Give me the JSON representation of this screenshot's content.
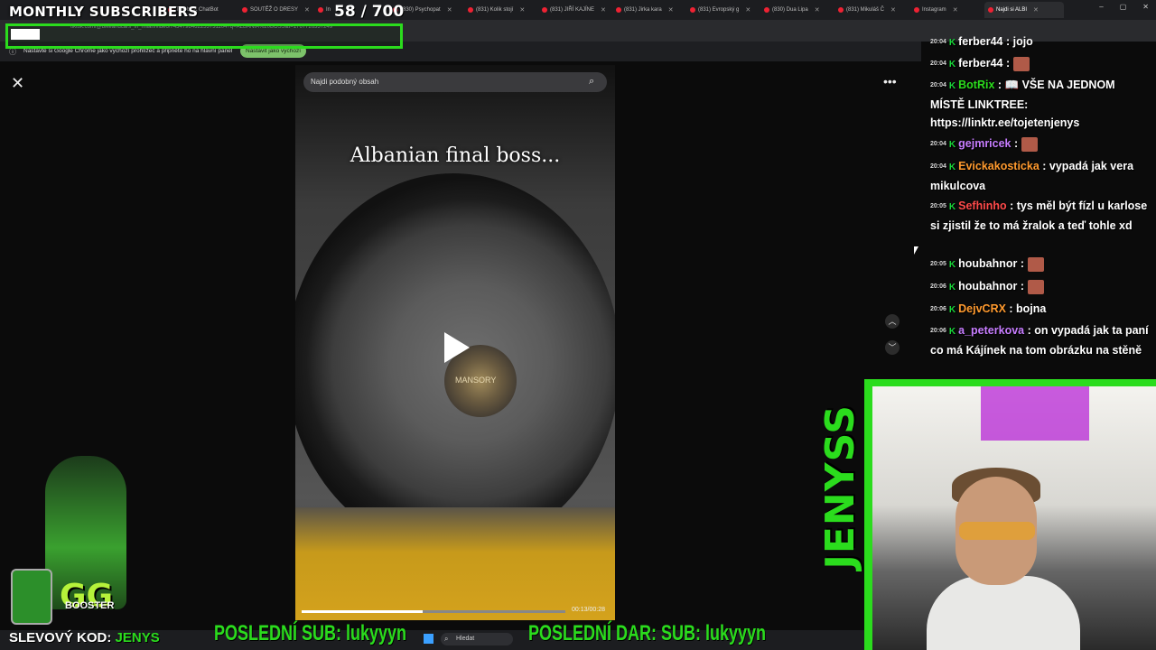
{
  "overlay": {
    "monthly_title": "MONTHLY SUBSCRIBERS",
    "sub_count": "58   / 700",
    "discount_label": "SLEVOVÝ KOD:",
    "discount_code": "JENYS",
    "last_sub": "POSLEDNÍ SUB: lukyyyn",
    "last_donation": "POSLEDNÍ DAR: SUB: lukyyyn",
    "booster_logo": "GG",
    "booster_label": "BOOSTER",
    "jenyss": "JENYSS"
  },
  "browser": {
    "tabs": [
      {
        "label": "The best ChatBot",
        "active": false
      },
      {
        "label": "SOUTĚŽ O DRESY",
        "active": false
      },
      {
        "label": "In",
        "active": false
      },
      {
        "label": "(830) Psychopat",
        "active": false
      },
      {
        "label": "(831) Kolik stojí",
        "active": false
      },
      {
        "label": "(831) JIŘÍ KAJÍNE",
        "active": false
      },
      {
        "label": "(831) Jirka kara",
        "active": false
      },
      {
        "label": "(831) Evropský g",
        "active": false
      },
      {
        "label": "(830) Dua Lipa",
        "active": false
      },
      {
        "label": "(831) Mikuláš Č",
        "active": false
      },
      {
        "label": "Instagram",
        "active": false
      },
      {
        "label": "Najdi si ALBI",
        "active": true
      }
    ],
    "url": "tiktok.com/@bikeandcars_in_milan/video/7434798462253731104?q=ALBANIA%20BOSS&t=1767726337249",
    "banner_text": "Nastavte si Google Chrome jako výchozí prohlížeč a připněte ho na hlavní panel",
    "banner_button": "Nastavit jako výchozí"
  },
  "video": {
    "search_placeholder": "Najdi podobný obsah",
    "caption": "Albanian final boss...",
    "time": "00:13/00:28",
    "progress": 0.46,
    "hub_text": "MANSORY"
  },
  "chat": {
    "messages": [
      {
        "time": "20:04",
        "user": "ferber44",
        "text": ": jojo",
        "color": "#ffffff",
        "emote": false
      },
      {
        "time": "20:04",
        "user": "ferber44",
        "text": ":",
        "color": "#ffffff",
        "emote": true
      },
      {
        "time": "20:04",
        "user": "BotRix",
        "text": ": 📖 VŠE NA JEDNOM MÍSTĚ LINKTREE: https://linktr.ee/tojetenjenys",
        "color": "#2bdc1d",
        "emote": false
      },
      {
        "time": "20:04",
        "user": "gejmricek",
        "text": ":",
        "color": "#c77dff",
        "emote": true
      },
      {
        "time": "20:04",
        "user": "Evickakosticka",
        "text": ": vypadá jak vera mikulcova",
        "color": "#ff9a2e",
        "emote": false
      },
      {
        "time": "20:05",
        "user": "Sefhinho",
        "text": ": tys měl být fízl u karlose si zjistil že to má žralok a teď tohle xd",
        "color": "#ff4a4a",
        "emote": false
      },
      {
        "time": "20:05",
        "user": "houbahnor",
        "text": ":",
        "color": "#ffffff",
        "emote": true
      },
      {
        "time": "20:06",
        "user": "houbahnor",
        "text": ":",
        "color": "#ffffff",
        "emote": true
      },
      {
        "time": "20:06",
        "user": "DejvCRX",
        "text": ": bojna",
        "color": "#ff9a2e",
        "emote": false
      },
      {
        "time": "20:06",
        "user": "a_peterkova",
        "text": ": on vypadá jak ta paní co má Kájínek na tom obrázku na stěně",
        "color": "#c77dff",
        "emote": false
      }
    ]
  },
  "taskbar": {
    "search_label": "Hledat"
  }
}
